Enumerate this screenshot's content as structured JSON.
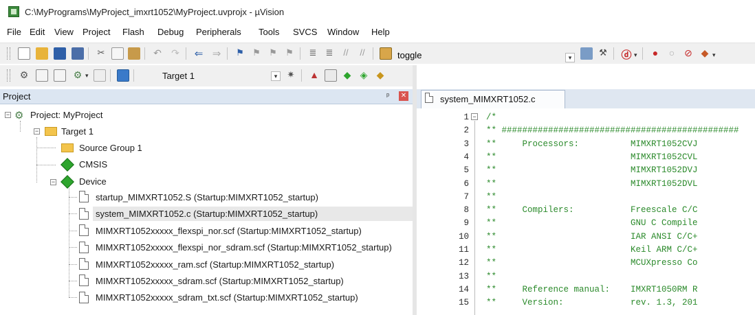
{
  "window": {
    "title": "C:\\MyPrograms\\MyProject_imxrt1052\\MyProject.uvprojx - µVision"
  },
  "menu": [
    "File",
    "Edit",
    "View",
    "Project",
    "Flash",
    "Debug",
    "Peripherals",
    "Tools",
    "SVCS",
    "Window",
    "Help"
  ],
  "toolbar1": {
    "find_combo_value": "toggle"
  },
  "toolbar2": {
    "target_combo_value": "Target 1"
  },
  "project_panel": {
    "title": "Project",
    "pin_glyph": "ᵖ",
    "close_glyph": "✕",
    "root": "Project: MyProject",
    "target": "Target 1",
    "groups": [
      "Source Group 1",
      "CMSIS",
      "Device"
    ],
    "device_files": [
      "startup_MIMXRT1052.S (Startup:MIMXRT1052_startup)",
      "system_MIMXRT1052.c (Startup:MIMXRT1052_startup)",
      "MIMXRT1052xxxxx_flexspi_nor.scf (Startup:MIMXRT1052_startup)",
      "MIMXRT1052xxxxx_flexspi_nor_sdram.scf (Startup:MIMXRT1052_startup)",
      "MIMXRT1052xxxxx_ram.scf (Startup:MIMXRT1052_startup)",
      "MIMXRT1052xxxxx_sdram.scf (Startup:MIMXRT1052_startup)",
      "MIMXRT1052xxxxx_sdram_txt.scf (Startup:MIMXRT1052_startup)"
    ],
    "selected_file_index": 1
  },
  "editor": {
    "tab_label": "system_MIMXRT1052.c",
    "lines": [
      {
        "n": "1",
        "text": "/*"
      },
      {
        "n": "2",
        "text": "** ##############################################"
      },
      {
        "n": "3",
        "text": "**     Processors:          MIMXRT1052CVJ"
      },
      {
        "n": "4",
        "text": "**                          MIMXRT1052CVL"
      },
      {
        "n": "5",
        "text": "**                          MIMXRT1052DVJ"
      },
      {
        "n": "6",
        "text": "**                          MIMXRT1052DVL"
      },
      {
        "n": "7",
        "text": "**"
      },
      {
        "n": "8",
        "text": "**     Compilers:           Freescale C/C"
      },
      {
        "n": "9",
        "text": "**                          GNU C Compile"
      },
      {
        "n": "10",
        "text": "**                          IAR ANSI C/C+"
      },
      {
        "n": "11",
        "text": "**                          Keil ARM C/C+"
      },
      {
        "n": "12",
        "text": "**                          MCUXpresso Co"
      },
      {
        "n": "13",
        "text": "**"
      },
      {
        "n": "14",
        "text": "**     Reference manual:    IMXRT1050RM R"
      },
      {
        "n": "15",
        "text": "**     Version:             rev. 1.3, 201"
      }
    ]
  },
  "colors": {
    "comment": "#2b8a2b",
    "panel_header": "#dce6f2",
    "selection": "#e8e8e8"
  }
}
